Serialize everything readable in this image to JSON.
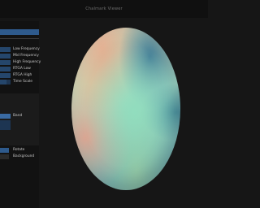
{
  "window": {
    "title": "Chalmark Viewer"
  },
  "sidebar": {
    "params": [
      {
        "label": "Low Frequency",
        "level": 1.0
      },
      {
        "label": "Mid Frequency",
        "level": 1.0
      },
      {
        "label": "High Frequency",
        "level": 1.0
      },
      {
        "label": "RTGA Low",
        "level": 1.0
      },
      {
        "label": "RTGA High",
        "level": 1.0
      },
      {
        "label": "Time Scale",
        "level": 0.6
      }
    ],
    "band": {
      "label": "Band"
    },
    "toggles": [
      {
        "label": "Rotate",
        "active": true
      },
      {
        "label": "Background",
        "active": false
      }
    ],
    "accent_color": "#2e5a8c"
  },
  "viewport": {
    "object": "sphere",
    "colors": [
      "#9fd9c6",
      "#3e7a96",
      "#e8aa8c",
      "#d2d2aa"
    ]
  }
}
